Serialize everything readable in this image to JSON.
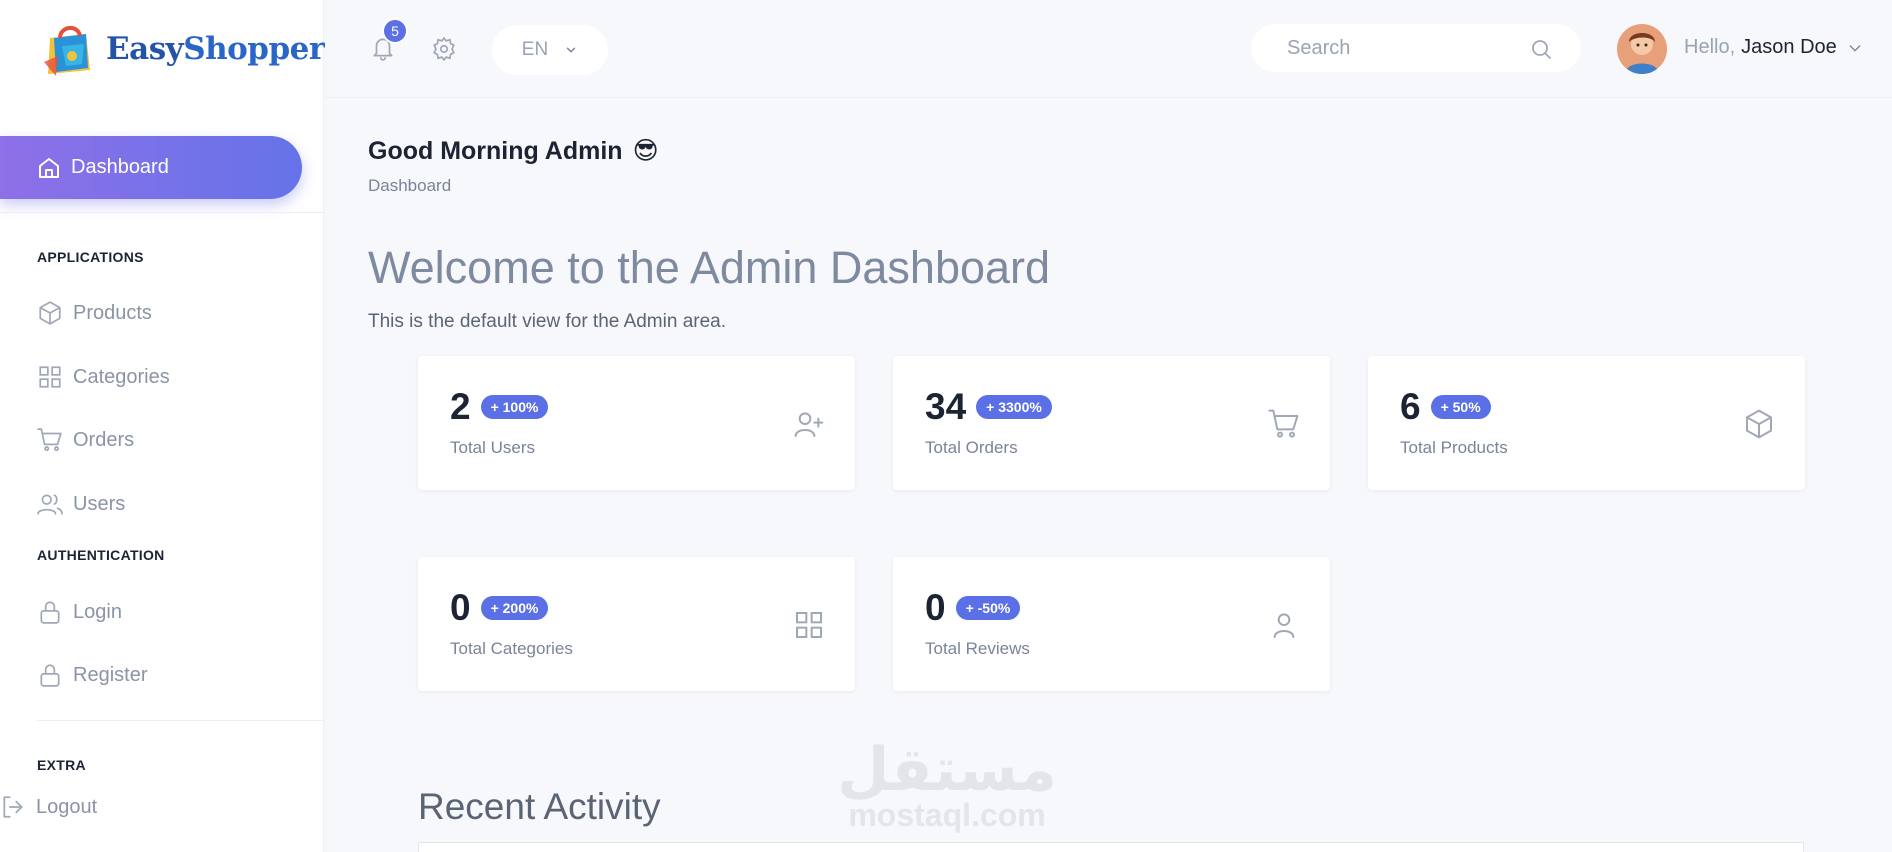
{
  "brand": {
    "name_part1": "Easy",
    "name_part2": "Shopper"
  },
  "sidebar": {
    "active_item": {
      "label": "Dashboard",
      "icon": "home-icon"
    },
    "sections": {
      "applications": "APPLICATIONS",
      "authentication": "AUTHENTICATION",
      "extra": "EXTRA"
    },
    "items": {
      "products": {
        "label": "Products",
        "icon": "box-icon"
      },
      "categories": {
        "label": "Categories",
        "icon": "grid-icon"
      },
      "orders": {
        "label": "Orders",
        "icon": "cart-icon"
      },
      "users": {
        "label": "Users",
        "icon": "users-icon"
      },
      "login": {
        "label": "Login",
        "icon": "lock-icon"
      },
      "register": {
        "label": "Register",
        "icon": "lock-icon"
      },
      "logout": {
        "label": "Logout",
        "icon": "logout-icon"
      }
    }
  },
  "topbar": {
    "notifications_count": "5",
    "language": "EN",
    "search_placeholder": "Search",
    "greeting": "Hello,",
    "user_name": "Jason Doe"
  },
  "header": {
    "greeting": "Good Morning Admin",
    "emoji": "😎",
    "breadcrumb": "Dashboard",
    "welcome_title": "Welcome to the Admin Dashboard",
    "welcome_text": "This is the default view for the Admin area."
  },
  "stats": {
    "users": {
      "value": "2",
      "change": "+ 100%",
      "label": "Total Users",
      "icon": "user-plus-icon"
    },
    "orders": {
      "value": "34",
      "change": "+ 3300%",
      "label": "Total Orders",
      "icon": "cart-icon"
    },
    "products": {
      "value": "6",
      "change": "+ 50%",
      "label": "Total Products",
      "icon": "box-icon"
    },
    "categories": {
      "value": "0",
      "change": "+ 200%",
      "label": "Total Categories",
      "icon": "grid-icon"
    },
    "reviews": {
      "value": "0",
      "change": "+ -50%",
      "label": "Total Reviews",
      "icon": "user-icon"
    }
  },
  "recent_activity": {
    "title": "Recent Activity"
  },
  "watermark": {
    "arabic": "مستقل",
    "latin": "mostaql.com"
  },
  "colors": {
    "accent": "#5b6fe6",
    "gradient_start": "#8e70e8",
    "gradient_end": "#6573e8",
    "logo": "#2454a8"
  }
}
